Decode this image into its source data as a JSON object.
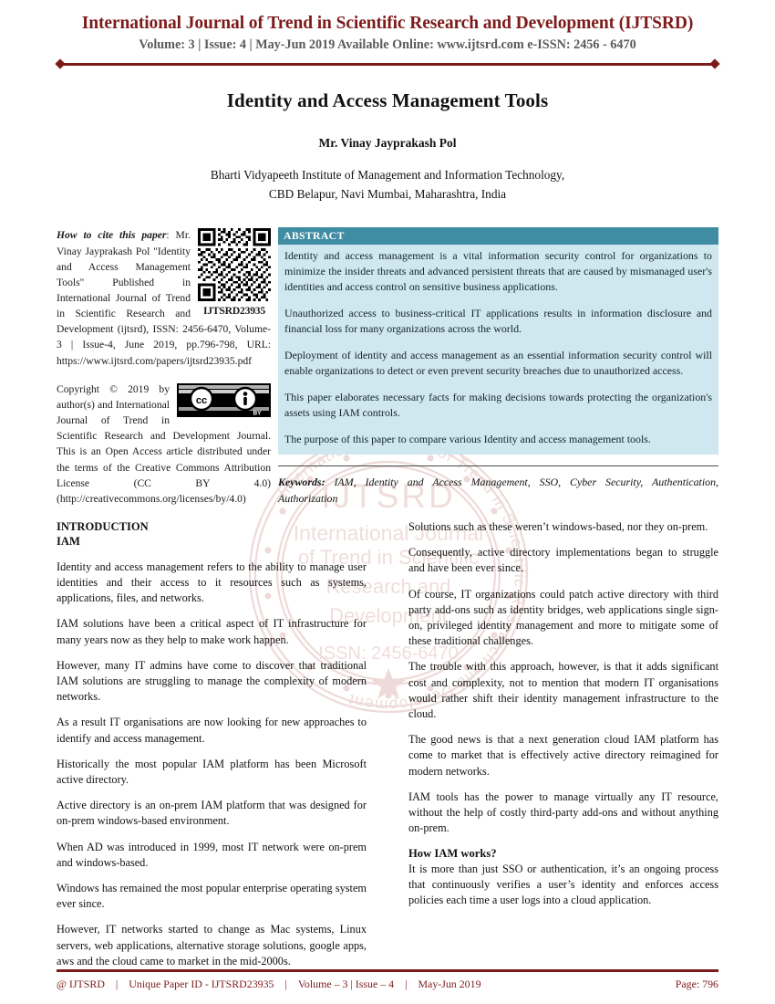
{
  "masthead": {
    "journal_title": "International Journal of Trend in Scientific Research and Development (IJTSRD)",
    "journal_sub": "Volume: 3 | Issue: 4 | May-Jun 2019 Available Online: www.ijtsrd.com e-ISSN: 2456 - 6470",
    "accent_color": "#7d1b1b"
  },
  "title_block": {
    "paper_title": "Identity and Access Management Tools",
    "author": "Mr. Vinay Jayprakash Pol",
    "affiliation_line1": "Bharti Vidyapeeth Institute of Management and Information Technology,",
    "affiliation_line2": "CBD Belapur, Navi Mumbai, Maharashtra, India"
  },
  "cite": {
    "lead": "How to cite this paper",
    "text": ": Mr. Vinay Jayprakash Pol \"Identity and Access Management Tools\" Published in International Journal of Trend in Scientific Research and Development (ijtsrd), ISSN: 2456-6470, Volume-3 | Issue-4, June 2019, pp.796-798, URL: https://www.ijtsrd.com/papers/ijtsrd23935.pdf",
    "qr_label": "IJTSRD23935",
    "qr_icon": "qr-code-icon"
  },
  "copyright": {
    "text_before_badge": "Copyright © 2019 by author(s) and International Journal of Trend in Scientific Research and Development Journal. This is an Open Access article distributed under the terms of the Creative Commons Attribution License (CC BY 4.0) (http://creativecommons.org/licenses/by/4.0)",
    "badge_icon": "creative-commons-by-icon",
    "badge_cc_label": "cc",
    "badge_by_label": "BY"
  },
  "abstract": {
    "heading": "ABSTRACT",
    "header_color": "#3f8ca3",
    "background_color": "#cfe7ee",
    "paragraphs": [
      "Identity and access management is a vital information security control for organizations to minimize the insider threats and advanced persistent threats that are caused by mismanaged user's identities and access control on sensitive business applications.",
      "Unauthorized access to business-critical IT applications results in information disclosure and financial loss for many organizations across the world.",
      "Deployment of identity and access management as an essential information security control will enable organizations to detect or even prevent security breaches due to unauthorized access.",
      "This paper elaborates necessary facts for making decisions towards protecting the organization's assets using IAM controls.",
      "The purpose of this paper to compare various Identity and access management tools."
    ]
  },
  "keywords": {
    "label": "Keywords:",
    "value": " IAM, Identity and Access Management, SSO, Cyber Security, Authentication, Authorization"
  },
  "body": {
    "left_column": {
      "section_heading": "INTRODUCTION",
      "sub_heading": "IAM",
      "paragraphs": [
        "Identity and access management refers to the ability to manage user identities and their access to it resources such as systems, applications, files, and networks.",
        "IAM solutions have been a critical aspect of IT infrastructure for many years now as they help to make work happen.",
        "However, many IT admins have come to discover that traditional IAM solutions are struggling to manage the complexity of modern networks.",
        "As a result IT organisations are now looking for new approaches to identify and access management.",
        "Historically the most popular IAM platform has been Microsoft active directory.",
        "Active directory is an on-prem IAM platform that was designed for on-prem windows-based environment.",
        "When AD was introduced in 1999, most IT network were on-prem and windows-based.",
        "Windows has remained the most popular enterprise operating system ever since.",
        "However, IT networks started to change as Mac systems, Linux servers, web applications, alternative storage solutions, google apps, aws and the cloud came to market in the mid-2000s."
      ]
    },
    "right_column": {
      "paragraphs": [
        "Solutions such as these weren’t windows-based, nor they on-prem.",
        "Consequently, active directory implementations began to struggle and have been ever since.",
        "Of course, IT organizations could patch active directory with third party add-ons such as identity bridges, web applications single sign-on, privileged identity management and more to mitigate some of these traditional challenges.",
        "The trouble with this approach, however, is that it adds significant cost and complexity, not to mention that modern IT organisations would rather shift their identity management infrastructure to the cloud.",
        "The good news is that a next generation cloud IAM platform has come to market that is effectively active directory reimagined for modern networks.",
        "IAM tools has the power to manage virtually any IT resource, without the help of costly third-party add-ons and without anything on-prem."
      ],
      "sub_heading": "How IAM works?",
      "paragraphs_after_heading": [
        "It is more than just SSO or authentication, it’s an ongoing process that continuously verifies a user’s identity and enforces access policies each time a user logs into a cloud application."
      ]
    }
  },
  "watermark": {
    "center_line1": "IJTSRD",
    "center_line2": "International Journal",
    "center_line3": "of Trend in Scientific",
    "center_line4": "Research and",
    "center_line5": "Development",
    "center_line6": "ISSN: 2456-6470",
    "ring_text": "International Journal of Trend in Scientific Research and Development",
    "color": "#d9a9a4"
  },
  "footer": {
    "brand": "@ IJTSRD",
    "paper_id": "Unique Paper ID - IJTSRD23935",
    "volume_issue": "Volume – 3 | Issue – 4",
    "date": "May-Jun 2019",
    "page": "Page: 796",
    "separator": "|",
    "color": "#7d1b1b"
  }
}
